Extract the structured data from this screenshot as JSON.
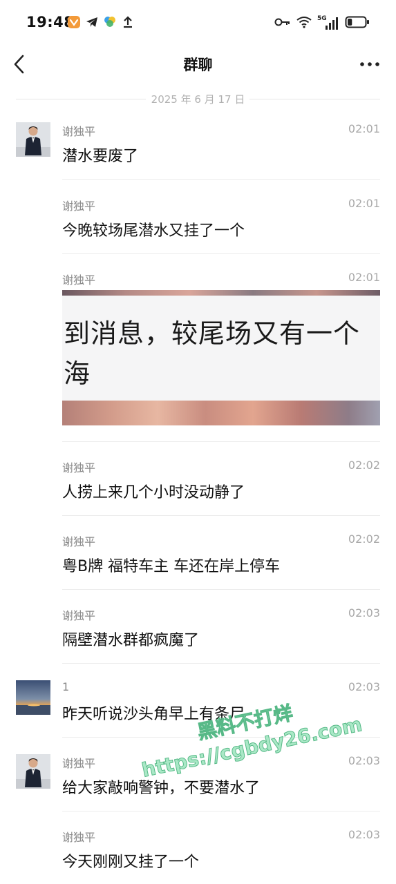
{
  "status_bar": {
    "time": "19:48",
    "left_icons": [
      "app-badge-icon",
      "telegram-icon",
      "color-app-icon",
      "upload-icon"
    ],
    "right_icons": [
      "key-icon",
      "wifi-icon",
      "5g-signal-icon",
      "battery-icon"
    ],
    "network_label": "5G",
    "battery_level_percent": 25
  },
  "nav": {
    "title": "群聊",
    "back_icon": "chevron-left-icon",
    "more_icon": "more-dots-icon"
  },
  "date_divider": "2025 年 6 月 17 日",
  "messages": [
    {
      "sender": "谢独平",
      "time": "02:01",
      "text": "潜水要废了",
      "avatar": "man-in-suit"
    },
    {
      "sender": "谢独平",
      "time": "02:01",
      "text": "今晚较场尾潜水又挂了一个"
    },
    {
      "sender": "谢独平",
      "time": "02:01",
      "image_text": [
        "到消息，较尾场又有一个",
        "海"
      ]
    },
    {
      "sender": "谢独平",
      "time": "02:02",
      "text": "人捞上来几个小时没动静了"
    },
    {
      "sender": "谢独平",
      "time": "02:02",
      "text": "粤B牌 福特车主 车还在岸上停车"
    },
    {
      "sender": "谢独平",
      "time": "02:03",
      "text": "隔壁潜水群都疯魔了"
    },
    {
      "sender": "1",
      "time": "02:03",
      "text": "昨天听说沙头角早上有条尸",
      "avatar": "sunset-sea"
    },
    {
      "sender": "谢独平",
      "time": "02:03",
      "text": "给大家敲响警钟，不要潜水了",
      "avatar": "man-in-suit"
    },
    {
      "sender": "谢独平",
      "time": "02:03",
      "text": "今天刚刚又挂了一个"
    }
  ],
  "watermark": {
    "line1": "黑料不打烊",
    "line2": "https://cgbdy26.com"
  },
  "colors": {
    "text_primary": "#111111",
    "text_secondary": "#8a8a8a",
    "divider": "#ececec",
    "watermark_fill": "#a9e8c6",
    "watermark_stroke": "#57b987"
  }
}
